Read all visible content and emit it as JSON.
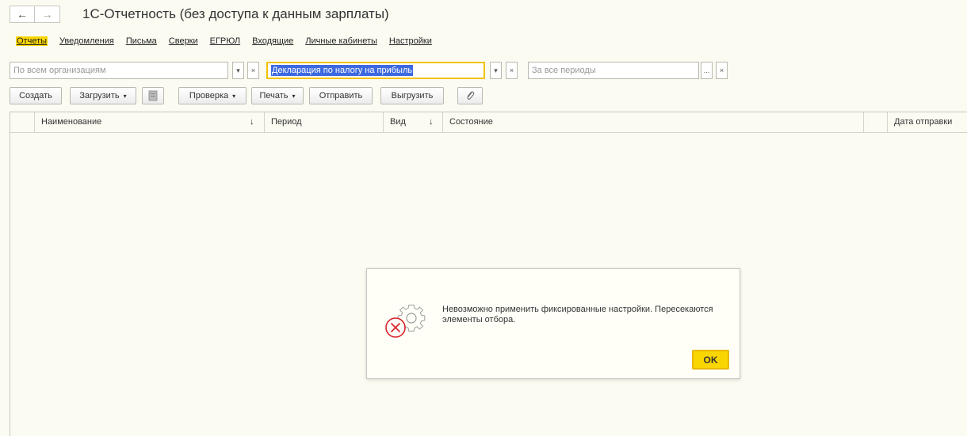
{
  "window": {
    "title": "1С-Отчетность (без доступа к данным зарплаты)",
    "back_icon": "←",
    "forward_icon": "→"
  },
  "sections": [
    {
      "label": "Отчеты",
      "active": true
    },
    {
      "label": "Уведомления"
    },
    {
      "label": "Письма"
    },
    {
      "label": "Сверки"
    },
    {
      "label": "ЕГРЮЛ"
    },
    {
      "label": "Входящие"
    },
    {
      "label": "Личные кабинеты"
    },
    {
      "label": "Настройки"
    }
  ],
  "filters": {
    "organization": {
      "placeholder": "По всем организациям",
      "value": ""
    },
    "report_type": {
      "value": "Декларация по налогу на прибыль"
    },
    "period": {
      "placeholder": "За все периоды",
      "value": ""
    },
    "dropdown_icon": "▾",
    "clear_icon": "×",
    "select_icon": "..."
  },
  "toolbar": {
    "create": "Создать",
    "load": "Загрузить",
    "check": "Проверка",
    "print": "Печать",
    "send": "Отправить",
    "export": "Выгрузить",
    "caret": "▾"
  },
  "grid": {
    "columns": [
      "Наименование",
      "Период",
      "Вид",
      "Состояние",
      "Дата отправки"
    ],
    "sort_icon": "↓"
  },
  "dialog": {
    "message": "Невозможно применить фиксированные настройки. Пересекаются элементы отбора.",
    "ok": "OK"
  }
}
